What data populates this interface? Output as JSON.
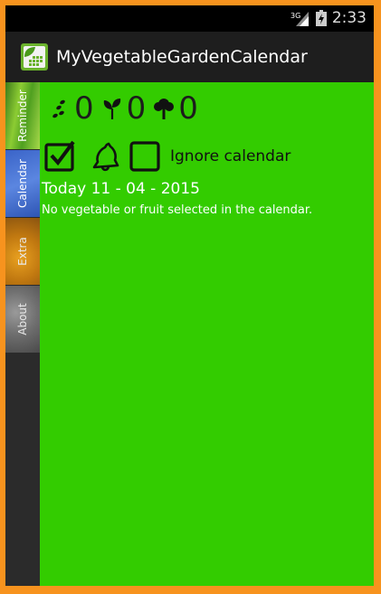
{
  "statusbar": {
    "network": "3G",
    "time": "2:33"
  },
  "app": {
    "title": "MyVegetableGardenCalendar"
  },
  "sidebar": {
    "tabs": [
      {
        "label": "Reminder"
      },
      {
        "label": "Calendar"
      },
      {
        "label": "Extra"
      },
      {
        "label": "About"
      }
    ]
  },
  "counters": {
    "seed_count": "0",
    "sprout_count": "0",
    "tree_count": "0"
  },
  "options": {
    "ignore_label": "Ignore calendar"
  },
  "today": {
    "text": "Today 11 - 04 - 2015"
  },
  "message": {
    "text": "No vegetable or fruit selected in the calendar."
  },
  "colors": {
    "frame": "#F7931E",
    "content_bg": "#33CC00",
    "actionbar_bg": "#1E1E1E"
  }
}
